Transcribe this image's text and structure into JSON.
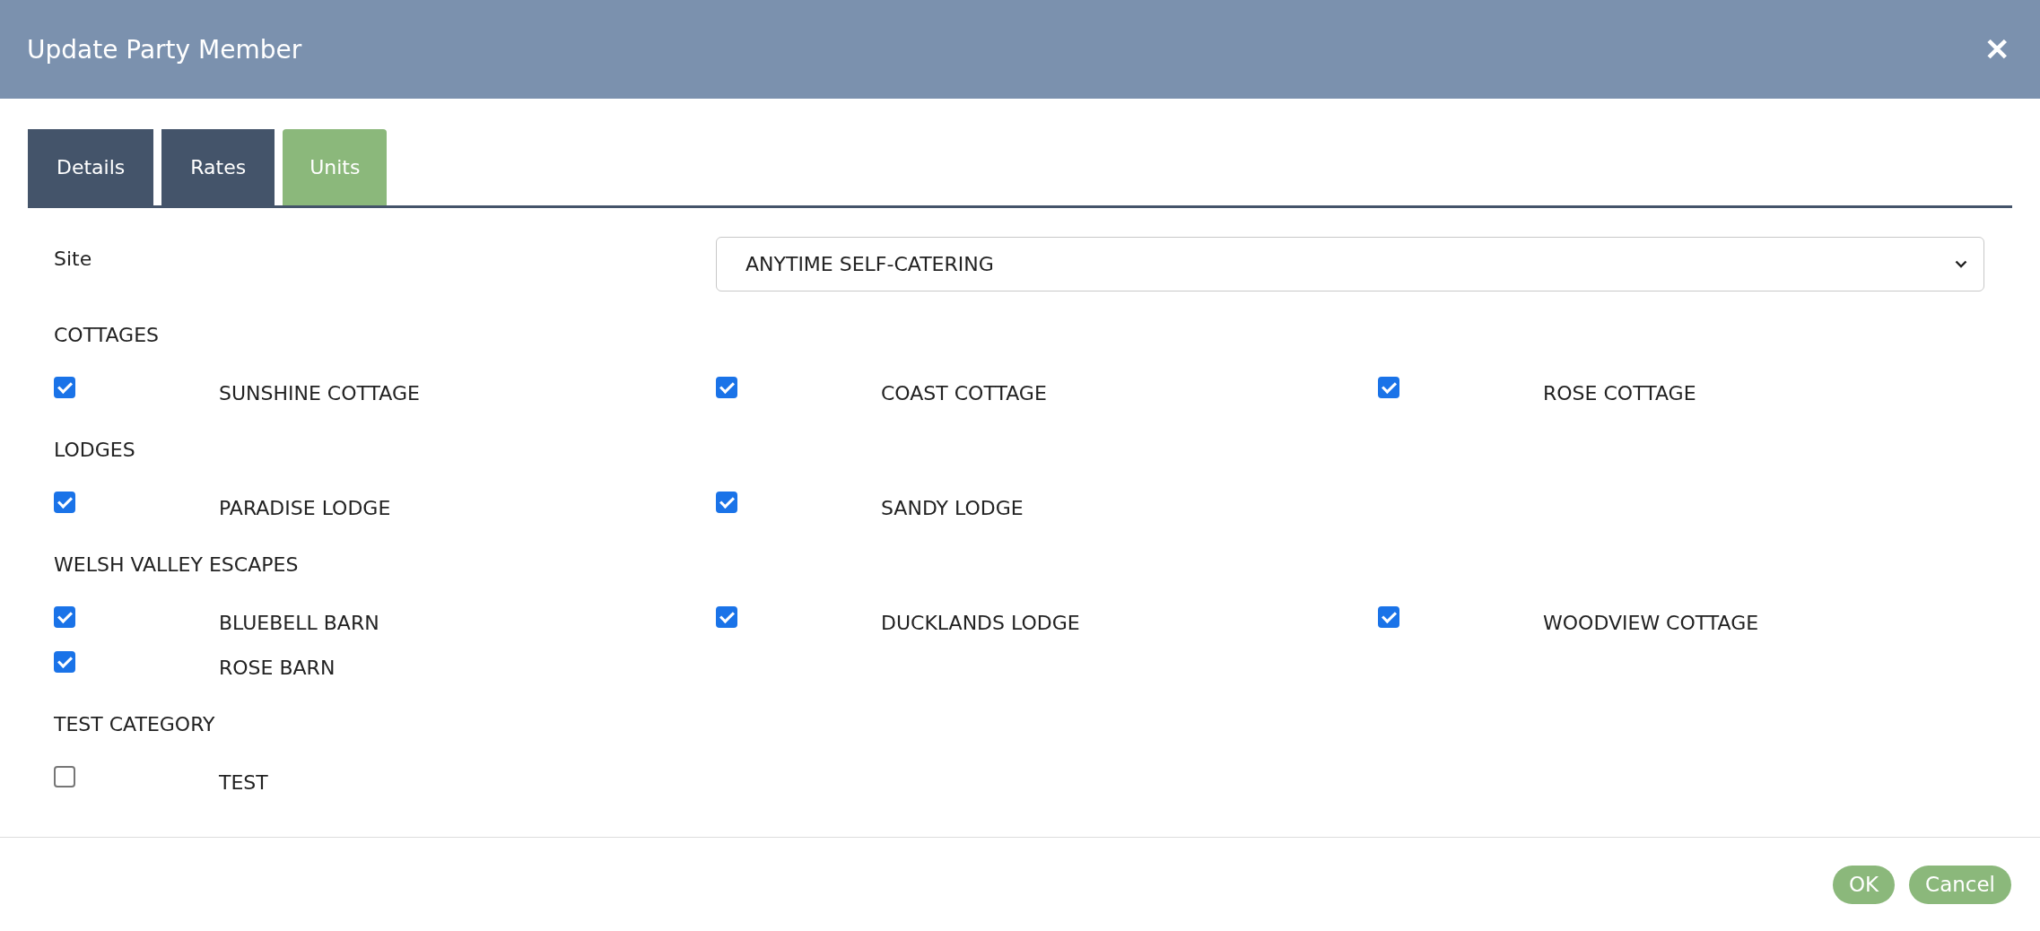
{
  "window": {
    "title": "Update Party Member",
    "close": "✕"
  },
  "tabs": [
    {
      "label": "Details",
      "selected": false
    },
    {
      "label": "Rates",
      "selected": false
    },
    {
      "label": "Units",
      "selected": true
    }
  ],
  "site": {
    "label": "Site",
    "value": "ANYTIME SELF-CATERING"
  },
  "categories": [
    {
      "name": "COTTAGES",
      "units": [
        {
          "name": "SUNSHINE COTTAGE",
          "checked": true
        },
        {
          "name": "COAST COTTAGE",
          "checked": true
        },
        {
          "name": "ROSE COTTAGE",
          "checked": true
        }
      ]
    },
    {
      "name": "LODGES",
      "units": [
        {
          "name": "PARADISE LODGE",
          "checked": true
        },
        {
          "name": "SANDY LODGE",
          "checked": true
        }
      ]
    },
    {
      "name": "WELSH VALLEY ESCAPES",
      "units": [
        {
          "name": "BLUEBELL BARN",
          "checked": true
        },
        {
          "name": "DUCKLANDS LODGE",
          "checked": true
        },
        {
          "name": "WOODVIEW COTTAGE",
          "checked": true
        },
        {
          "name": "ROSE BARN",
          "checked": true
        }
      ]
    },
    {
      "name": "TEST CATEGORY",
      "units": [
        {
          "name": "TEST",
          "checked": false
        }
      ]
    }
  ],
  "buttons": [
    "OK",
    "Cancel"
  ]
}
